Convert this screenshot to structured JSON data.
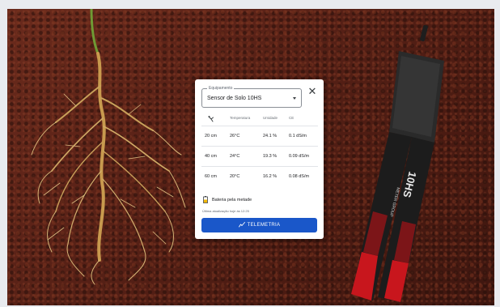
{
  "device_card": {
    "equipment_label": "Equipamento",
    "equipment_value": "Sensor de Solo 10HS",
    "close_icon": "close-icon",
    "table": {
      "headers": [
        "",
        "Temperatura",
        "Umidade",
        "CE"
      ],
      "header_icon": "probe-icon",
      "rows": [
        {
          "depth": "20 cm",
          "temp": "26°C",
          "humidity": "24.1 %",
          "ce": "0.1 dS/m"
        },
        {
          "depth": "40 cm",
          "temp": "24°C",
          "humidity": "19.3 %",
          "ce": "0.09 dS/m"
        },
        {
          "depth": "60 cm",
          "temp": "20°C",
          "humidity": "16.2 %",
          "ce": "0.08 dS/m"
        }
      ]
    },
    "battery": {
      "icon": "battery-half-icon",
      "text": "Bateria pela metade",
      "color": "#f2b705"
    },
    "last_update": "Última atualização hoje às 12:25",
    "telemetry_button": {
      "icon": "telemetry-icon",
      "label": "TELEMETRIA",
      "color": "#1a57c9"
    }
  },
  "sensor_device": {
    "brand_text": "10HS",
    "maker_text": "METER GROUP"
  }
}
